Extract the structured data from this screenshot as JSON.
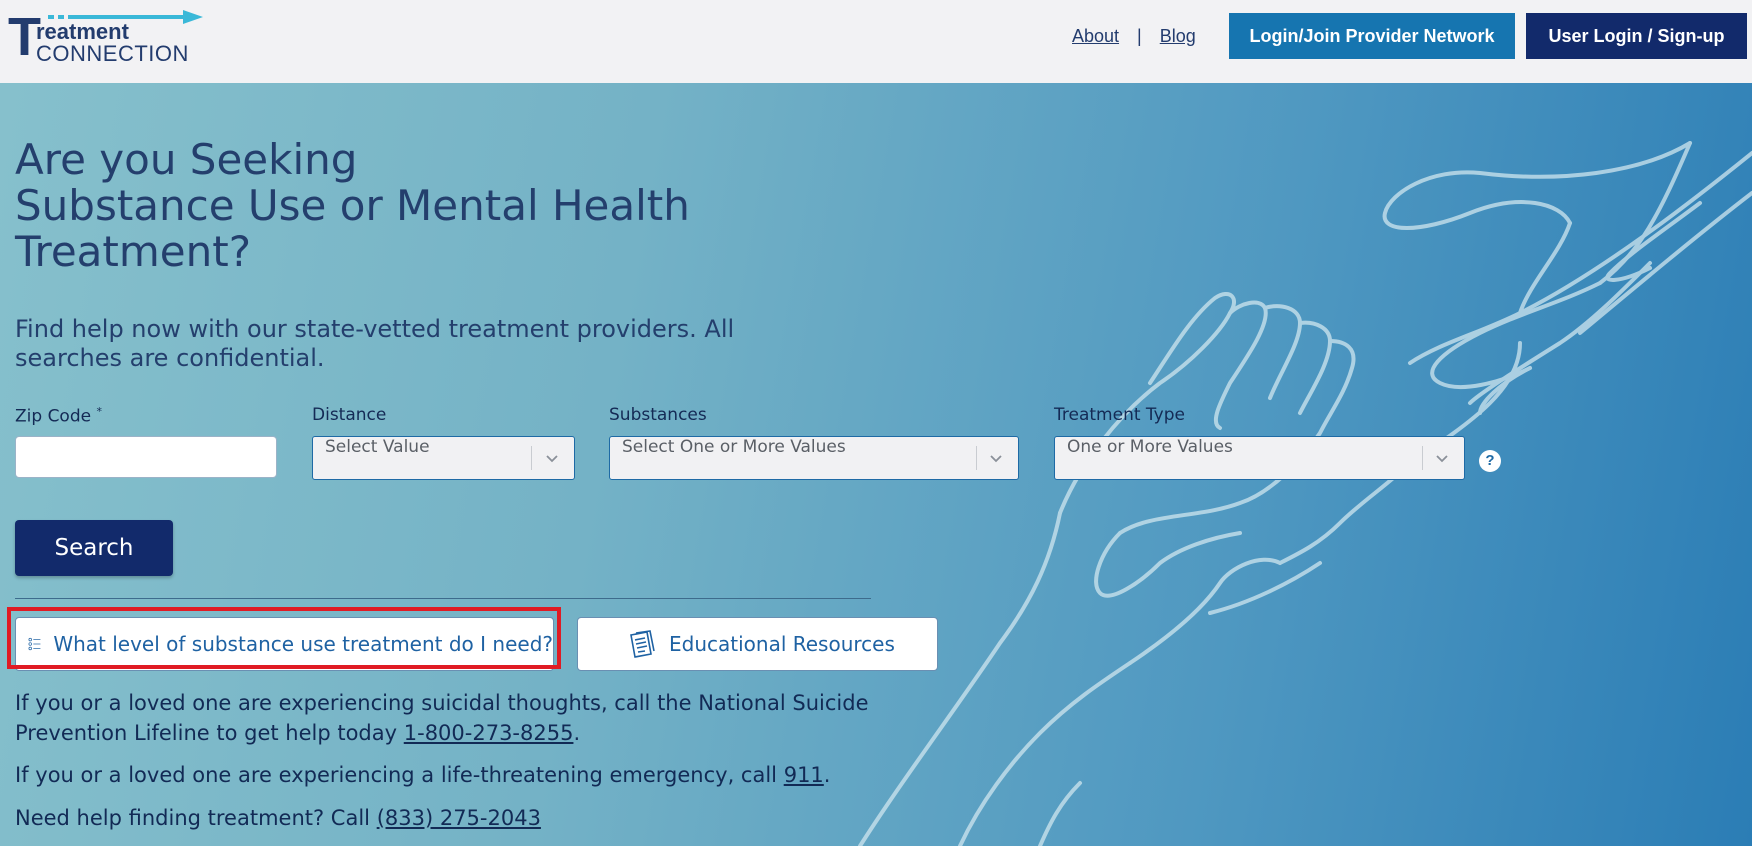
{
  "brand": {
    "logo_letter": "T",
    "logo_line1": "reatment",
    "logo_line2": "CONNECTION"
  },
  "nav": {
    "about": "About",
    "separator": "|",
    "blog": "Blog",
    "provider_button": "Login/Join Provider Network",
    "user_button": "User Login / Sign-up"
  },
  "hero": {
    "title_line1": "Are you Seeking",
    "title_line2": "Substance Use or Mental Health",
    "title_line3": "Treatment?",
    "subtitle": "Find help now with our state-vetted treatment providers. All searches are confidential."
  },
  "form": {
    "zip_label": "Zip Code",
    "zip_required_mark": "*",
    "zip_value": "",
    "distance_label": "Distance",
    "distance_placeholder": "Select Value",
    "substances_label": "Substances",
    "substances_placeholder": "Select One or More Values",
    "treatment_label": "Treatment Type",
    "treatment_placeholder": "One or More Values",
    "help_glyph": "?",
    "search_label": "Search"
  },
  "resources": {
    "level_button": "What level of substance use treatment do I need?",
    "level_icon": "checklist-icon",
    "edu_button": "Educational Resources",
    "edu_icon": "documents-icon"
  },
  "info": {
    "suicide_text_1": "If you or a loved one are experiencing suicidal thoughts, call the National Suicide Prevention Lifeline to get help today ",
    "suicide_phone": "1-800-273-8255",
    "suicide_end": ".",
    "emergency_text": "If you or a loved one are experiencing a life-threatening emergency, call ",
    "emergency_phone": "911",
    "emergency_end": ".",
    "help_text": "Need help finding treatment? Call ",
    "help_phone": "(833) 275-2043"
  },
  "colors": {
    "navy": "#122a6b",
    "provider_blue": "#1675b0",
    "highlight_red": "#e01b24"
  }
}
